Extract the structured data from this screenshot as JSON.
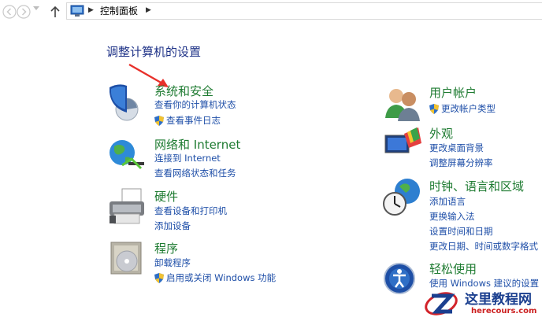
{
  "address_bar": {
    "path": "控制面板"
  },
  "page_title": "调整计算机的设置",
  "categories": [
    {
      "title": "系统和安全",
      "links": [
        "查看你的计算机状态",
        "查看事件日志"
      ]
    },
    {
      "title": "网络和 Internet",
      "links": [
        "连接到 Internet",
        "查看网络状态和任务"
      ]
    },
    {
      "title": "硬件",
      "links": [
        "查看设备和打印机",
        "添加设备"
      ]
    },
    {
      "title": "程序",
      "links": [
        "卸载程序",
        "启用或关闭 Windows 功能"
      ]
    },
    {
      "title": "用户帐户",
      "links": [
        "更改帐户类型"
      ]
    },
    {
      "title": "外观",
      "links": [
        "更改桌面背景",
        "调整屏幕分辨率"
      ]
    },
    {
      "title": "时钟、语言和区域",
      "links": [
        "添加语言",
        "更换输入法",
        "设置时间和日期",
        "更改日期、时间或数字格式"
      ]
    },
    {
      "title": "轻松使用",
      "links": [
        "使用 Windows 建议的设置"
      ]
    }
  ],
  "watermark": {
    "title": "这里教程网",
    "subtitle": "herecours.com"
  },
  "colors": {
    "category_title": "#1e7b31",
    "link": "#1f4fa8",
    "heading": "#1e3287",
    "annotation_arrow": "#e8302a"
  }
}
